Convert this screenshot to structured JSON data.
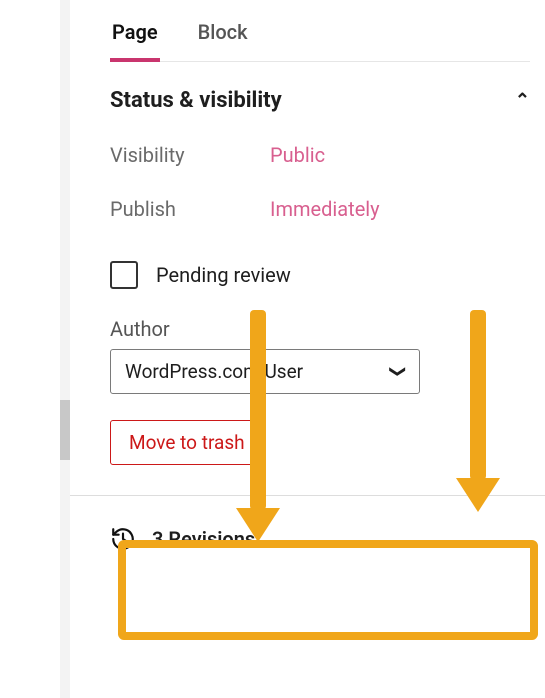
{
  "tabs": {
    "page": "Page",
    "block": "Block",
    "active": "page"
  },
  "section": {
    "title": "Status & visibility",
    "rows": {
      "visibility": {
        "label": "Visibility",
        "value": "Public"
      },
      "publish": {
        "label": "Publish",
        "value": "Immediately"
      }
    },
    "pending_review_label": "Pending review",
    "author": {
      "label": "Author",
      "selected": "WordPress.com User"
    },
    "trash_label": "Move to trash"
  },
  "revisions": {
    "count": "3",
    "label": "3 Revisions"
  }
}
